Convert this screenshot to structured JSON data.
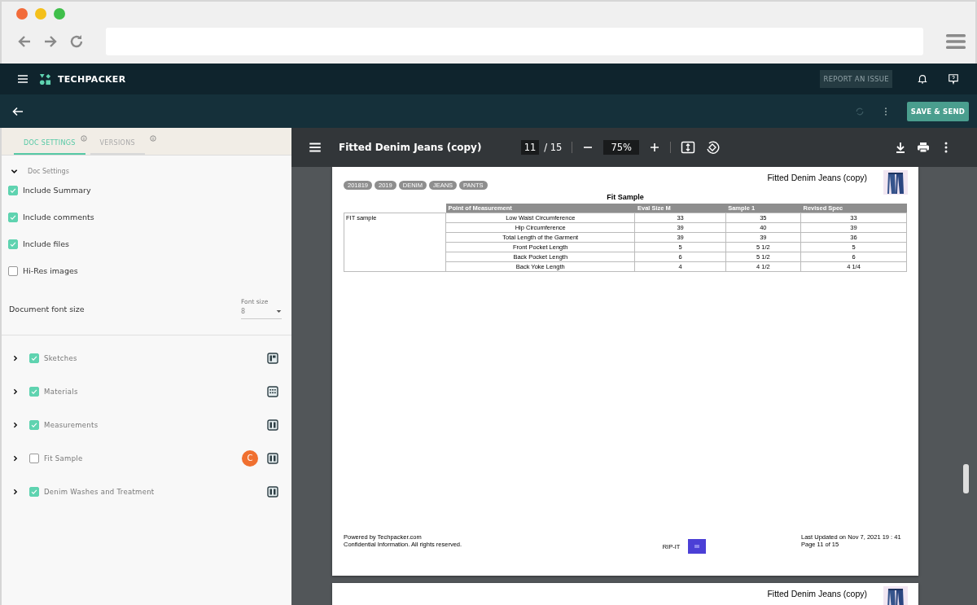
{
  "app_header": {
    "brand": "TECHPACKER",
    "report_button": "REPORT AN ISSUE"
  },
  "action_bar": {
    "save_button": "SAVE & SEND"
  },
  "panel": {
    "tabs": [
      {
        "label": "DOC SETTINGS",
        "selected": true
      },
      {
        "label": "VERSIONS",
        "selected": false
      }
    ],
    "section": {
      "title": "Doc Settings",
      "expanded": true
    },
    "options": [
      {
        "label": "Include Summary",
        "checked": true
      },
      {
        "label": "Include comments",
        "checked": true
      },
      {
        "label": "Include files",
        "checked": true
      },
      {
        "label": "Hi-Res images",
        "checked": false
      }
    ],
    "font_size": {
      "label": "Document font size",
      "field_label": "Font size",
      "value": "8"
    },
    "sections": [
      {
        "label": "Sketches",
        "checked": true
      },
      {
        "label": "Materials",
        "checked": true
      },
      {
        "label": "Measurements",
        "checked": true
      },
      {
        "label": "Fit Sample",
        "checked": false,
        "badge": "C"
      },
      {
        "label": "Denim Washes and Treatment",
        "checked": true
      }
    ]
  },
  "viewer": {
    "title": "Fitted Denim Jeans (copy)",
    "page": "11",
    "page_total": "/ 15",
    "zoom": "75%"
  },
  "pages": [
    {
      "title": "Fitted Denim Jeans (copy)",
      "tags": [
        "201819",
        "2019",
        "DENIM",
        "JEANS",
        "PANTS"
      ],
      "table": {
        "title": "Fit Sample",
        "group": "FIT sample",
        "columns": [
          "Point of Measurement",
          "Eval Size M",
          "Sample 1",
          "Revised Spec"
        ],
        "rows": [
          [
            "Low Waist Circumference",
            "33",
            "35",
            "33"
          ],
          [
            "Hip Circumference",
            "39",
            "40",
            "39"
          ],
          [
            "Total Length of the Garment",
            "39",
            "39",
            "36"
          ],
          [
            "Front Pocket Length",
            "5",
            "5 1/2",
            "5"
          ],
          [
            "Back Pocket Length",
            "6",
            "5 1/2",
            "6"
          ],
          [
            "Back Yoke Length",
            "4",
            "4 1/2",
            "4 1/4"
          ]
        ]
      },
      "footer": {
        "left": [
          "Powered by Techpacker.com",
          "Confidential Information. All rights reserved."
        ],
        "center": "RIP-IT",
        "right": [
          "Last Updated on Nov 7, 2021 19 : 41",
          "Page 11 of 15"
        ]
      }
    },
    {
      "title": "Fitted Denim Jeans (copy)"
    }
  ]
}
